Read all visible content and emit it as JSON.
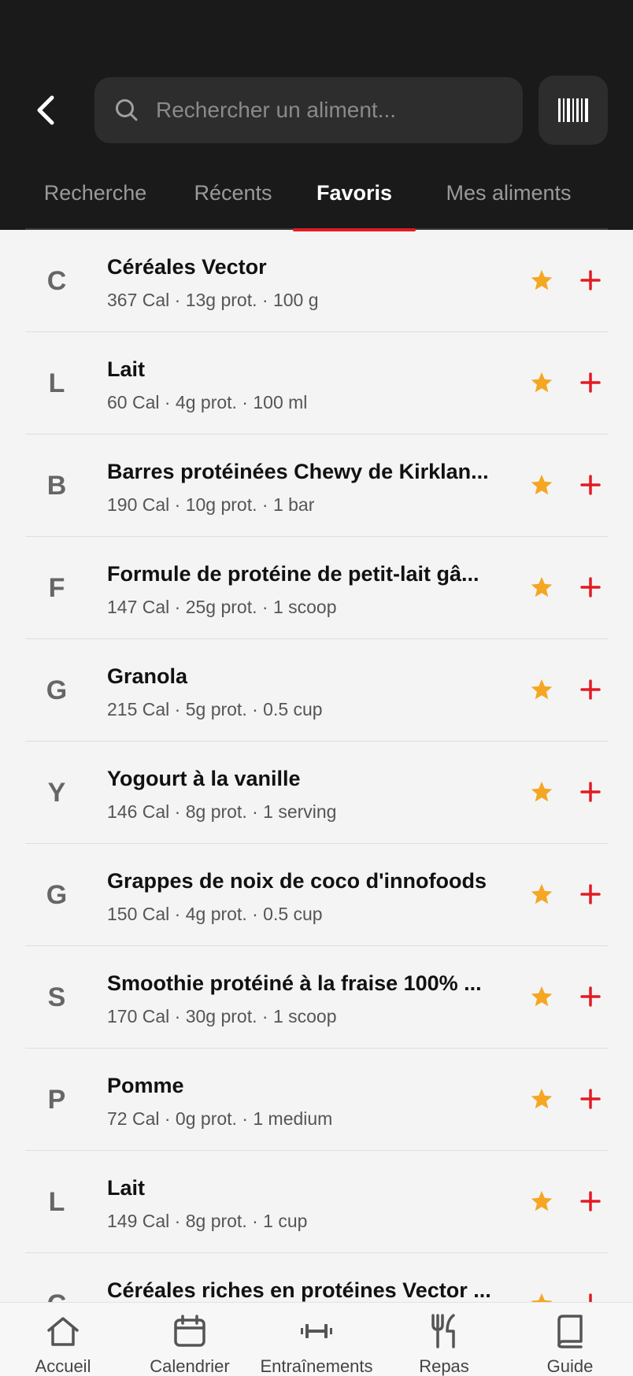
{
  "header": {
    "search_placeholder": "Rechercher un aliment..."
  },
  "tabs": [
    {
      "label": "Recherche",
      "active": false
    },
    {
      "label": "Récents",
      "active": false
    },
    {
      "label": "Favoris",
      "active": true
    },
    {
      "label": "Mes aliments",
      "active": false
    }
  ],
  "foods": [
    {
      "initial": "C",
      "name": "Céréales Vector",
      "meta": "367 Cal · 13g prot. · 100 g"
    },
    {
      "initial": "L",
      "name": "Lait",
      "meta": "60 Cal · 4g prot. · 100 ml"
    },
    {
      "initial": "B",
      "name": "Barres protéinées Chewy de Kirklan...",
      "meta": "190 Cal · 10g prot. · 1 bar"
    },
    {
      "initial": "F",
      "name": "Formule de protéine de petit-lait gâ...",
      "meta": "147 Cal · 25g prot. · 1 scoop"
    },
    {
      "initial": "G",
      "name": "Granola",
      "meta": "215 Cal · 5g prot. · 0.5 cup"
    },
    {
      "initial": "Y",
      "name": "Yogourt à la vanille",
      "meta": "146 Cal · 8g prot. · 1 serving"
    },
    {
      "initial": "G",
      "name": "Grappes de noix de coco d'innofoods",
      "meta": "150 Cal · 4g prot. · 0.5 cup"
    },
    {
      "initial": "S",
      "name": "Smoothie protéiné à la fraise 100% ...",
      "meta": "170 Cal · 30g prot. · 1 scoop"
    },
    {
      "initial": "P",
      "name": "Pomme",
      "meta": "72 Cal · 0g prot. · 1 medium"
    },
    {
      "initial": "L",
      "name": "Lait",
      "meta": "149 Cal · 8g prot. · 1 cup"
    },
    {
      "initial": "C",
      "name": "Céréales riches en protéines Vector ...",
      "meta": ""
    }
  ],
  "bottom_nav": [
    {
      "label": "Accueil",
      "icon": "home-icon"
    },
    {
      "label": "Calendrier",
      "icon": "calendar-icon"
    },
    {
      "label": "Entraînements",
      "icon": "dumbbell-icon"
    },
    {
      "label": "Repas",
      "icon": "fork-knife-icon"
    },
    {
      "label": "Guide",
      "icon": "book-icon"
    }
  ],
  "colors": {
    "header_bg": "#1a1a1a",
    "accent_red": "#e21b23",
    "star_orange": "#f5a623",
    "list_bg": "#f4f4f4"
  }
}
